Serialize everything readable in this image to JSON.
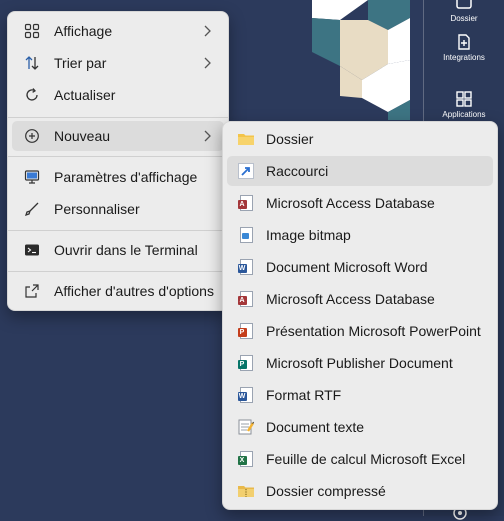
{
  "context_menu": {
    "items": [
      {
        "label": "Affichage",
        "icon": "grid-view-icon",
        "submenu": true
      },
      {
        "label": "Trier par",
        "icon": "sort-icon",
        "submenu": true
      },
      {
        "label": "Actualiser",
        "icon": "refresh-icon",
        "submenu": false
      },
      {
        "label": "Nouveau",
        "icon": "new-plus-icon",
        "submenu": true
      },
      {
        "label": "Paramètres d'affichage",
        "icon": "display-settings-icon",
        "submenu": false
      },
      {
        "label": "Personnaliser",
        "icon": "paintbrush-icon",
        "submenu": false
      },
      {
        "label": "Ouvrir dans le Terminal",
        "icon": "terminal-icon",
        "submenu": false
      },
      {
        "label": "Afficher d'autres d'options",
        "icon": "more-options-icon",
        "submenu": false
      }
    ]
  },
  "new_submenu": {
    "items": [
      {
        "label": "Dossier",
        "icon": "folder-icon"
      },
      {
        "label": "Raccourci",
        "icon": "shortcut-icon"
      },
      {
        "label": "Microsoft Access Database",
        "icon": "access-icon"
      },
      {
        "label": "Image bitmap",
        "icon": "bitmap-icon"
      },
      {
        "label": "Document Microsoft Word",
        "icon": "word-icon"
      },
      {
        "label": "Microsoft Access Database",
        "icon": "access-icon"
      },
      {
        "label": "Présentation Microsoft PowerPoint",
        "icon": "powerpoint-icon"
      },
      {
        "label": "Microsoft Publisher Document",
        "icon": "publisher-icon"
      },
      {
        "label": "Format RTF",
        "icon": "rtf-icon"
      },
      {
        "label": "Document texte",
        "icon": "text-document-icon"
      },
      {
        "label": "Feuille de calcul Microsoft Excel",
        "icon": "excel-icon"
      },
      {
        "label": "Dossier compressé",
        "icon": "zip-folder-icon"
      }
    ]
  },
  "rail": {
    "items": [
      {
        "label": "Dossier",
        "icon": "folder-outline-icon"
      },
      {
        "label": "Integrations",
        "icon": "integrations-icon"
      },
      {
        "label": "Applications",
        "icon": "apps-grid-icon"
      }
    ]
  },
  "colors": {
    "desktop": "#2c3a5c",
    "menu_bg": "#ececec",
    "highlight": "#dcdcdc",
    "teal": "#3d7483",
    "cream": "#e8dcc4"
  }
}
